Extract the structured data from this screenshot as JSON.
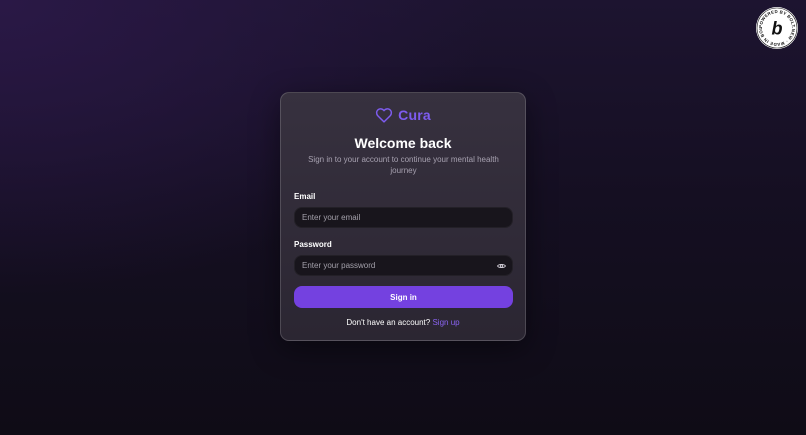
{
  "brand": {
    "name": "Cura",
    "icon": "heart-icon",
    "accent": "#7e5cf0"
  },
  "login": {
    "title": "Welcome back",
    "subtitle": "Sign in to your account to continue your mental health journey",
    "email": {
      "label": "Email",
      "placeholder": "Enter your email",
      "value": ""
    },
    "password": {
      "label": "Password",
      "placeholder": "Enter your password",
      "value": "",
      "toggle_icon": "eye-icon"
    },
    "submit_label": "Sign in",
    "signup_prompt": "Don't have an account?",
    "signup_link": "Sign up"
  },
  "badge": {
    "text": "POWERED BY BOLT.NEW · MADE IN BOLT.NEW · ",
    "icon": "bolt-logo-icon"
  },
  "colors": {
    "primary_button": "#7441e0",
    "link": "#8a63f0",
    "card": "#2f2a36",
    "input_bg": "#18151c"
  }
}
